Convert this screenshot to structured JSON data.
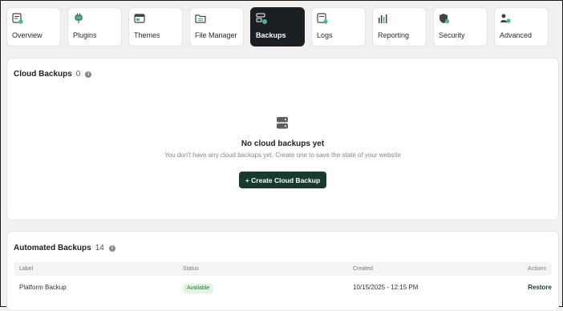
{
  "tabs": [
    {
      "label": "Overview",
      "icon": "overview-icon"
    },
    {
      "label": "Plugins",
      "icon": "plugin-icon"
    },
    {
      "label": "Themes",
      "icon": "themes-icon"
    },
    {
      "label": "File Manager",
      "icon": "folder-icon"
    },
    {
      "label": "Backups",
      "icon": "backup-server-icon",
      "active": true
    },
    {
      "label": "Logs",
      "icon": "logs-icon"
    },
    {
      "label": "Reporting",
      "icon": "bar-chart-icon"
    },
    {
      "label": "Security",
      "icon": "shield-icon"
    },
    {
      "label": "Advanced",
      "icon": "advanced-settings-icon"
    }
  ],
  "cloud": {
    "title": "Cloud Backups",
    "count": "0",
    "empty_title": "No cloud backups yet",
    "empty_sub": "You don't have any cloud backups yet. Create one to save the state of your website",
    "create_button": "+ Create Cloud Backup"
  },
  "automated": {
    "title": "Automated Backups",
    "count": "14",
    "columns": {
      "label": "Label",
      "status": "Status",
      "created": "Created",
      "actions": "Actions"
    },
    "rows": [
      {
        "label": "Platform Backup",
        "status": "Available",
        "created": "10/15/2025 - 12:15 PM",
        "action": "Restore"
      }
    ]
  },
  "colors": {
    "accent": "#173a2f",
    "active_tab": "#1b1f23",
    "icon_green": "#3fbf7f",
    "badge_bg": "#e3f4e2"
  }
}
